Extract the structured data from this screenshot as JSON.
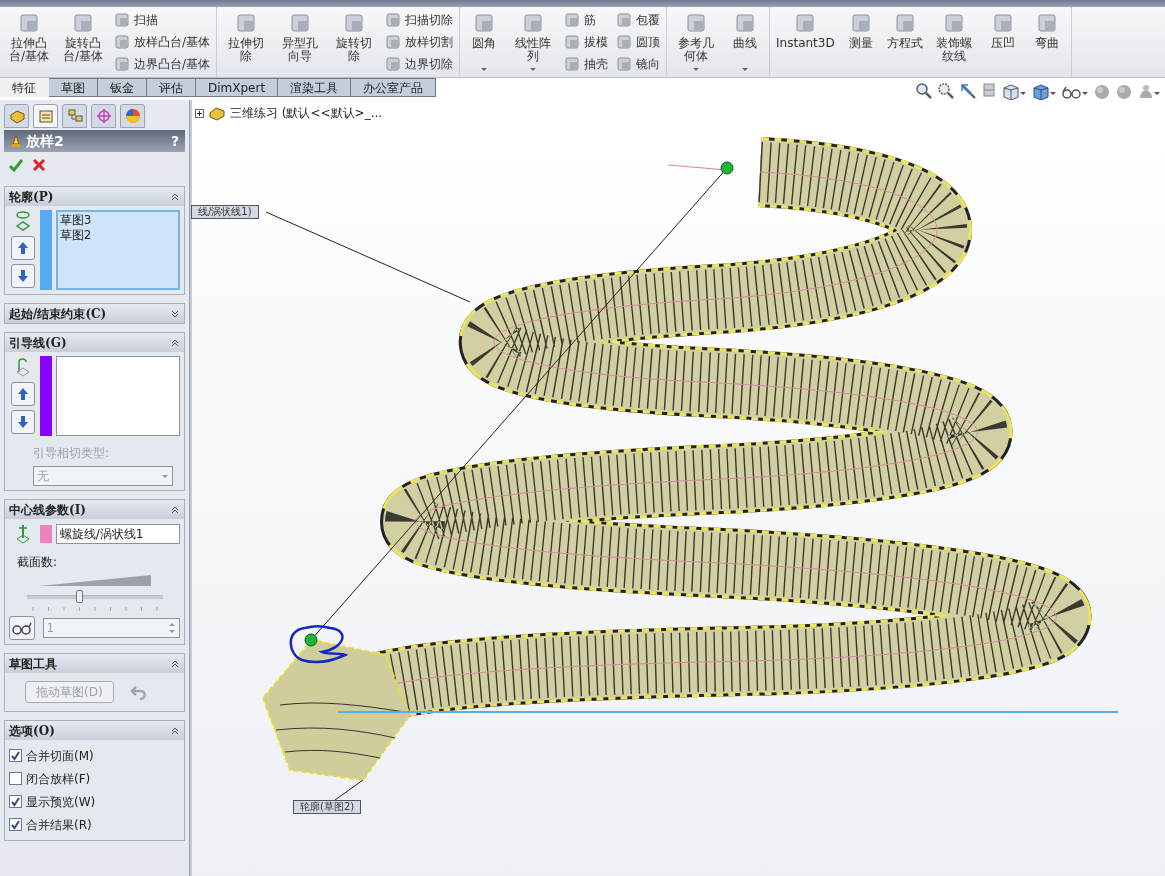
{
  "toolbar": {
    "groups": [
      {
        "columns": [
          {
            "kind": "large",
            "items": [
              {
                "label": "拉伸凸台/基体",
                "menu": false
              }
            ]
          },
          {
            "kind": "large",
            "items": [
              {
                "label": "旋转凸台/基体",
                "menu": false
              }
            ]
          },
          {
            "kind": "stack",
            "items": [
              {
                "label": "扫描"
              },
              {
                "label": "放样凸台/基体"
              },
              {
                "label": "边界凸台/基体"
              }
            ]
          }
        ]
      },
      {
        "columns": [
          {
            "kind": "large",
            "items": [
              {
                "label": "拉伸切除",
                "menu": false
              }
            ]
          },
          {
            "kind": "large",
            "items": [
              {
                "label": "异型孔向导",
                "menu": false
              }
            ]
          },
          {
            "kind": "large",
            "items": [
              {
                "label": "旋转切除",
                "menu": false
              }
            ]
          },
          {
            "kind": "stack",
            "items": [
              {
                "label": "扫描切除"
              },
              {
                "label": "放样切割"
              },
              {
                "label": "边界切除"
              }
            ]
          }
        ]
      },
      {
        "columns": [
          {
            "kind": "large",
            "items": [
              {
                "label": "圆角",
                "menu": true
              }
            ]
          },
          {
            "kind": "large",
            "items": [
              {
                "label": "线性阵列",
                "menu": true
              }
            ]
          },
          {
            "kind": "stack",
            "items": [
              {
                "label": "筋"
              },
              {
                "label": "拔模"
              },
              {
                "label": "抽壳"
              }
            ]
          },
          {
            "kind": "stack",
            "items": [
              {
                "label": "包覆"
              },
              {
                "label": "圆顶"
              },
              {
                "label": "镜向"
              }
            ]
          }
        ]
      },
      {
        "columns": [
          {
            "kind": "large",
            "items": [
              {
                "label": "参考几何体",
                "menu": true
              }
            ]
          },
          {
            "kind": "large",
            "items": [
              {
                "label": "曲线",
                "menu": true
              }
            ]
          }
        ]
      },
      {
        "columns": [
          {
            "kind": "large",
            "items": [
              {
                "label": "Instant3D",
                "menu": false
              }
            ]
          },
          {
            "kind": "large",
            "items": [
              {
                "label": "测量",
                "menu": false
              }
            ]
          },
          {
            "kind": "large",
            "items": [
              {
                "label": "方程式",
                "menu": false
              }
            ]
          },
          {
            "kind": "large",
            "items": [
              {
                "label": "装饰螺纹线",
                "menu": false
              }
            ]
          },
          {
            "kind": "large",
            "items": [
              {
                "label": "压凹",
                "menu": false
              }
            ]
          },
          {
            "kind": "large",
            "items": [
              {
                "label": "弯曲",
                "menu": false
              }
            ]
          }
        ]
      }
    ]
  },
  "tabs": [
    {
      "label": "特征",
      "selected": true
    },
    {
      "label": "草图",
      "selected": false
    },
    {
      "label": "钣金",
      "selected": false
    },
    {
      "label": "评估",
      "selected": false
    },
    {
      "label": "DimXpert",
      "selected": false
    },
    {
      "label": "渲染工具",
      "selected": false
    },
    {
      "label": "办公室产品",
      "selected": false
    }
  ],
  "panel": {
    "tabs": [
      {
        "selected": false
      },
      {
        "selected": true
      },
      {
        "selected": false
      },
      {
        "selected": false
      },
      {
        "selected": false
      }
    ],
    "title": "放样2",
    "help": "?",
    "sections": [
      {
        "kind": "profile",
        "title": "轮廓(P)",
        "expanded": true,
        "color": "#55aaf5",
        "items": [
          "草图3",
          "草图2"
        ]
      },
      {
        "title": "起始/结束约束(C)",
        "expanded": false
      },
      {
        "kind": "guides",
        "title": "引导线(G)",
        "expanded": true,
        "color": "#8a00ff",
        "tangency_label": "引导相切类型:",
        "tangency_value": "无",
        "disabled": true
      },
      {
        "kind": "centerline",
        "title": "中心线参数(I)",
        "expanded": true,
        "color": "#f080c0",
        "curve": "螺旋线/涡状线1",
        "sections_label": "截面数:",
        "level": 0.38,
        "count": "1",
        "disabled": true
      },
      {
        "kind": "sketch_tools",
        "title": "草图工具",
        "expanded": true,
        "button": "拖动草图(D)",
        "disabled": true
      },
      {
        "kind": "options",
        "title": "选项(O)",
        "expanded": true,
        "checkboxes": [
          {
            "label": "合并切面(M)",
            "checked": true
          },
          {
            "label": "闭合放样(F)",
            "checked": false
          },
          {
            "label": "显示预览(W)",
            "checked": true
          },
          {
            "label": "合并结果(R)",
            "checked": true
          }
        ]
      }
    ]
  },
  "viewport": {
    "tree_label": "三维练习 (默认<<默认>_...",
    "callouts": [
      {
        "text": "线/涡状线1)"
      },
      {
        "text": "轮廓(草图2)"
      }
    ]
  }
}
